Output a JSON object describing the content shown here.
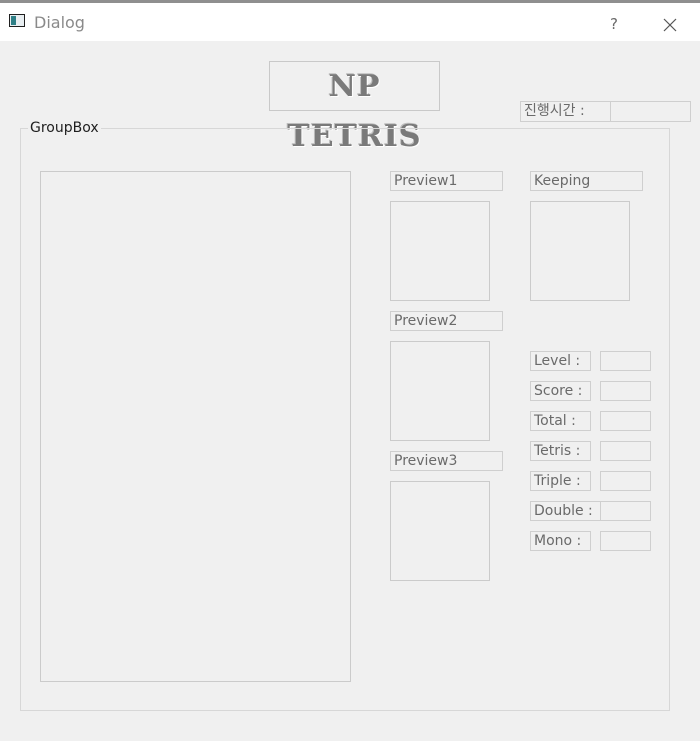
{
  "window": {
    "title": "Dialog",
    "help_label": "?"
  },
  "logo": {
    "text": "NP TETRIS"
  },
  "elapsed": {
    "label": "진행시간 :",
    "value": ""
  },
  "group": {
    "title": "GroupBox"
  },
  "previews": {
    "preview1": "Preview1",
    "preview2": "Preview2",
    "preview3": "Preview3",
    "keeping": "Keeping"
  },
  "stats": {
    "level": {
      "label": "Level :",
      "value": ""
    },
    "score": {
      "label": "Score :",
      "value": ""
    },
    "total": {
      "label": "Total :",
      "value": ""
    },
    "tetris": {
      "label": "Tetris :",
      "value": ""
    },
    "triple": {
      "label": "Triple :",
      "value": ""
    },
    "double": {
      "label": "Double :",
      "value": ""
    },
    "mono": {
      "label": "Mono :",
      "value": ""
    }
  }
}
